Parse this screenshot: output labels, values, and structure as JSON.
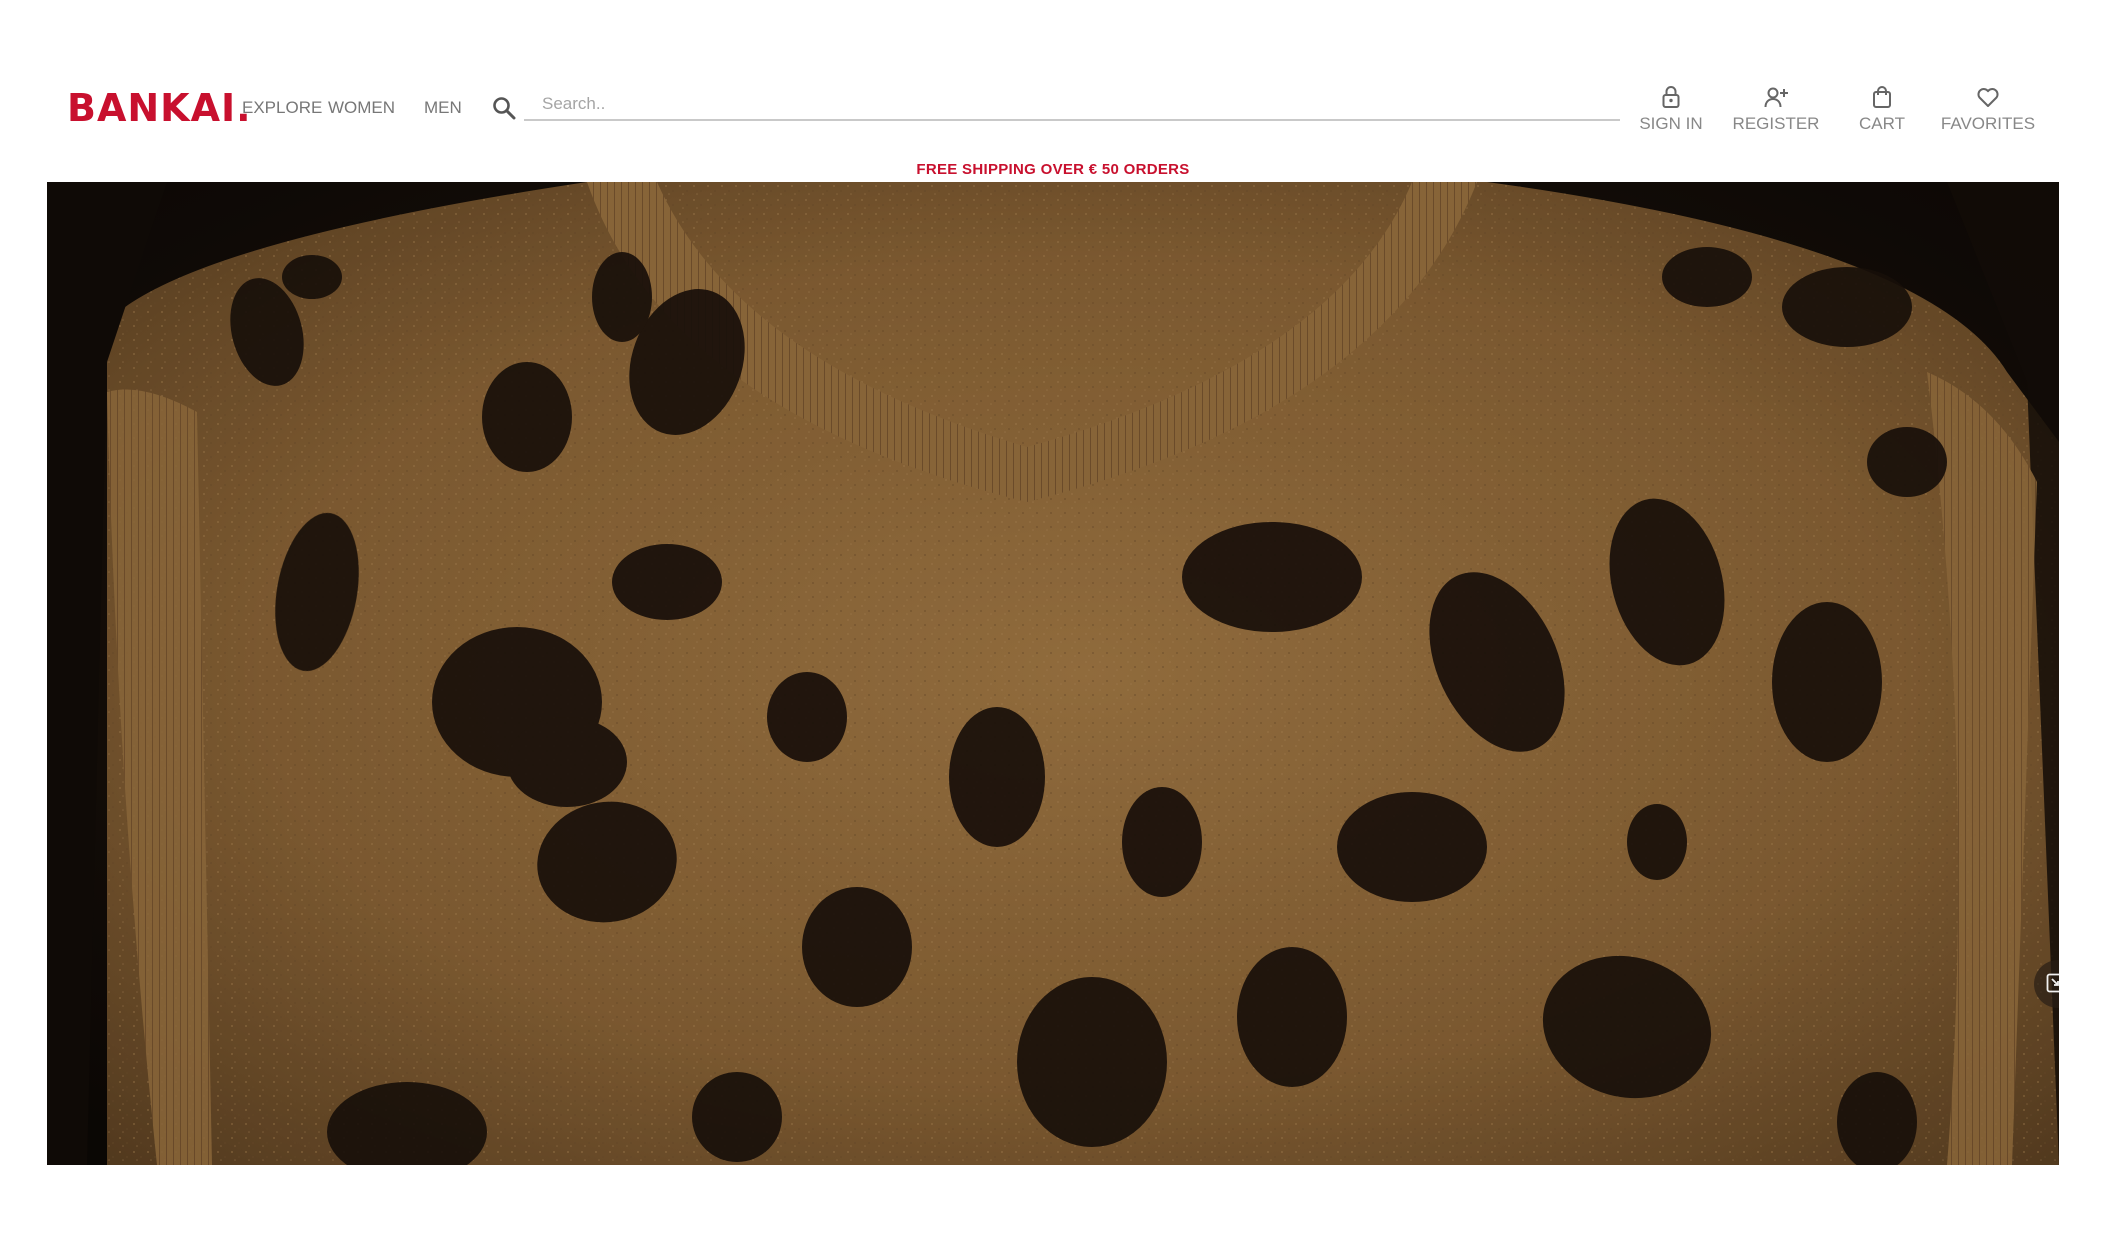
{
  "brand": {
    "logo_text": "BANKAI.",
    "accent_color": "#c8102e"
  },
  "nav": {
    "items": [
      {
        "label": "EXPLORE"
      },
      {
        "label": "WOMEN"
      },
      {
        "label": "MEN"
      }
    ]
  },
  "search": {
    "icon": "search-icon",
    "placeholder": "Search..",
    "value": ""
  },
  "actions": [
    {
      "label": "SIGN IN",
      "icon": "lock-icon"
    },
    {
      "label": "REGISTER",
      "icon": "add-user-icon"
    },
    {
      "label": "CART",
      "icon": "shopping-bag-icon"
    },
    {
      "label": "FAVORITES",
      "icon": "heart-icon"
    }
  ],
  "promo_banner": {
    "text": "FREE SHIPPING OVER € 50 ORDERS"
  },
  "hero": {
    "media": "leopard-print knit sweater vest video",
    "pip_icon": "picture-in-picture-icon"
  }
}
